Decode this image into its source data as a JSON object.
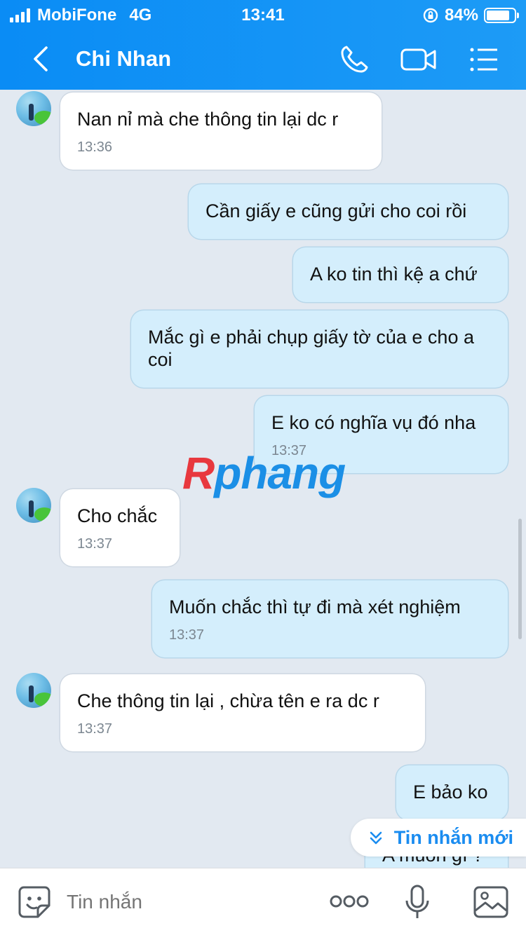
{
  "status_bar": {
    "carrier": "MobiFone",
    "network": "4G",
    "time": "13:41",
    "battery_percent": "84%",
    "battery_level": 0.84
  },
  "header": {
    "back_icon": "chevron-left-icon",
    "contact_name": "Chi Nhan",
    "call_icon": "phone-icon",
    "video_icon": "video-camera-icon",
    "menu_icon": "list-menu-icon"
  },
  "messages": [
    {
      "direction": "in",
      "text": "Nan nỉ mà che thông tin lại dc r",
      "time": "13:36"
    },
    {
      "direction": "out",
      "text": "Cần giấy e cũng gửi cho coi rồi"
    },
    {
      "direction": "out",
      "text": "A ko tin thì kệ a chứ"
    },
    {
      "direction": "out",
      "text": "Mắc gì e phải chụp giấy tờ của e cho a coi"
    },
    {
      "direction": "out",
      "text": "E ko có nghĩa vụ đó nha",
      "time": "13:37"
    },
    {
      "direction": "in",
      "text": "Cho chắc",
      "time": "13:37"
    },
    {
      "direction": "out",
      "text": "Muốn chắc thì tự đi mà xét nghiệm",
      "time": "13:37"
    },
    {
      "direction": "in",
      "text": "Che thông tin lại , chừa tên e ra dc r",
      "time": "13:37"
    },
    {
      "direction": "out",
      "text": "E bảo ko"
    },
    {
      "direction": "out",
      "text": "A muốn gì ?"
    }
  ],
  "watermark": {
    "first": "R",
    "rest": "phang"
  },
  "new_message_button": {
    "label": "Tin nhắn mới",
    "icon": "double-chevron-down-icon"
  },
  "input_bar": {
    "placeholder": "Tin nhắn",
    "emoji_icon": "sticker-icon",
    "more_icon": "more-dots-icon",
    "mic_icon": "microphone-icon",
    "image_icon": "image-icon"
  },
  "colors": {
    "header": "#0a8cf5",
    "chat_bg": "#e2e9f1",
    "incoming_bubble": "#ffffff",
    "outgoing_bubble": "#d4eefc",
    "accent": "#1a8cf0"
  }
}
